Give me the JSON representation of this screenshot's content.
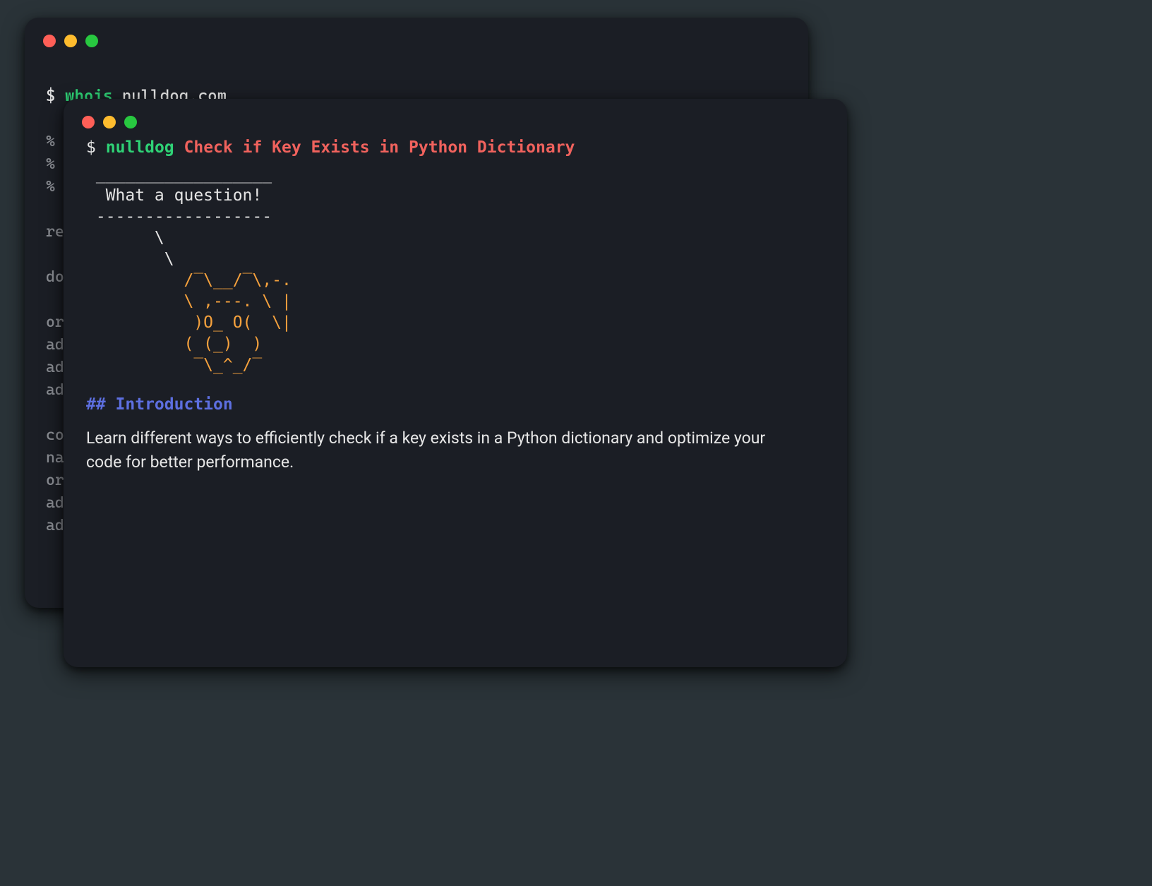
{
  "back_window": {
    "prompt": "$",
    "command": "whois",
    "argument": "nulldog.com",
    "output": "% IANA WHOIS server\n% for more information on IANA, visit http://www.iana.org\n% This query returned 1 object\n\nrefer:        whois.verisign-grs.com\n\ndomain:       COM\n\norganisation: VeriSign Global Registry Services\naddress:      12061 Bluemont Way\naddress:      Reston VA 20190\naddress:      United States of America (the)\n\ncontact:      administrative\nname:         Registry Customer Service\norganisation: VeriSign Global Registry Services\naddress:      12061 Bluemont Way\naddress:      Reston VA 20190\n"
  },
  "front_window": {
    "prompt": "$",
    "command": "nulldog",
    "title": "Check if Key Exists in Python Dictionary",
    "speech_top": " __________________",
    "speech_text": "  What a question!",
    "speech_bottom": " ------------------",
    "dog_tail1": "       \\",
    "dog_tail2": "        \\",
    "dog_l1": "          /‾\\__/‾\\,-.",
    "dog_l2": "          \\ ,---. \\ |",
    "dog_l3": "           )O_ O(  \\|",
    "dog_l4": "          ( (_)  )",
    "dog_l5": "           ‾\\_^_/‾",
    "section": "## Introduction",
    "body": "Learn different ways to efficiently check if a key exists in a Python dictionary and optimize your code for better performance."
  }
}
